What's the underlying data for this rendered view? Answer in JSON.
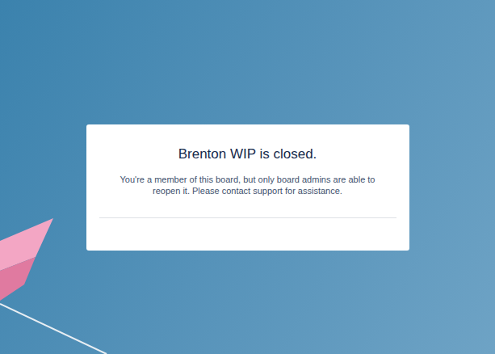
{
  "dialog": {
    "title": "Brenton WIP is closed.",
    "message": "You're a member of this board, but only board admins are able to reopen it. Please contact support for assistance."
  }
}
